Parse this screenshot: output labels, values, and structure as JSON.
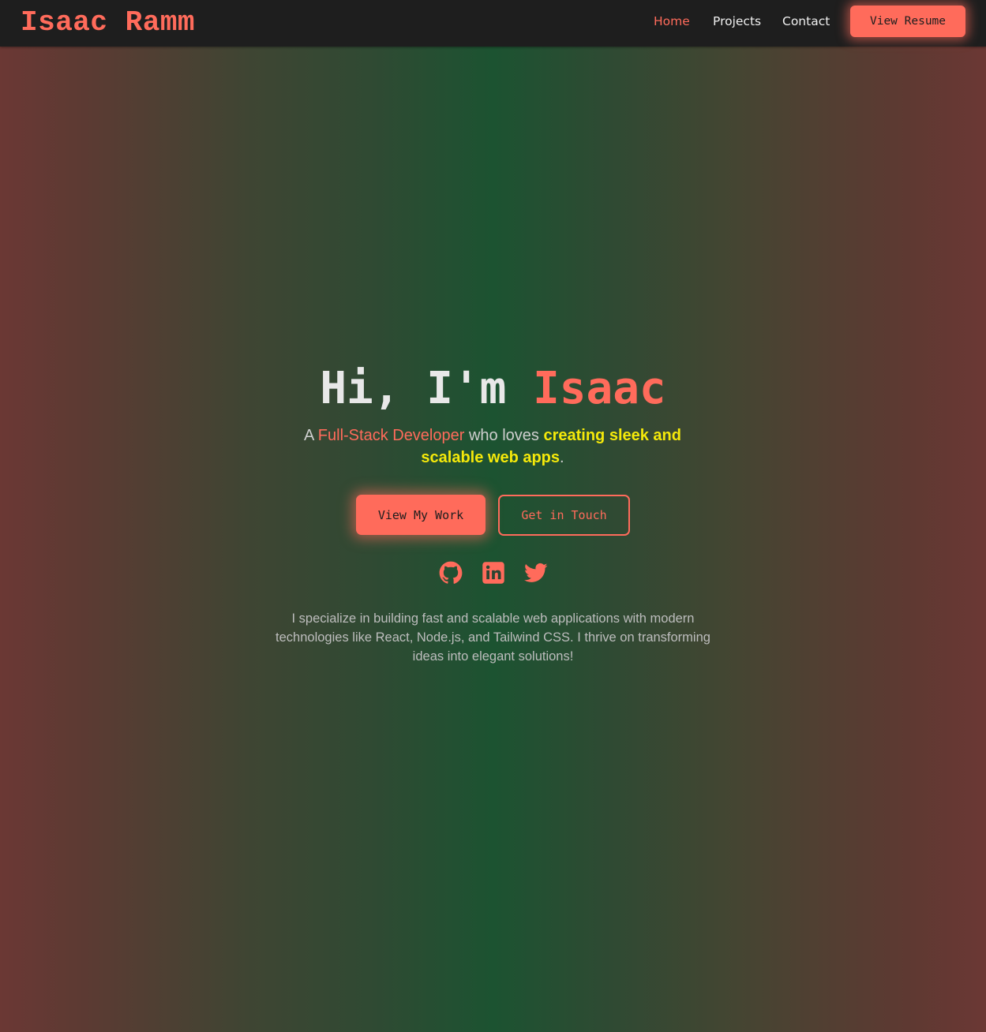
{
  "nav": {
    "brand": "Isaac Ramm",
    "links": [
      {
        "label": "Home",
        "active": true
      },
      {
        "label": "Projects",
        "active": false
      },
      {
        "label": "Contact",
        "active": false
      }
    ],
    "resume_label": "View Resume"
  },
  "hero": {
    "greeting": "Hi, I'm ",
    "name": "Isaac",
    "tagline": {
      "prefix": "A ",
      "role": "Full-Stack Developer",
      "middle": " who loves ",
      "highlight": "creating sleek and scalable web apps",
      "suffix": "."
    },
    "primary_button": "View My Work",
    "secondary_button": "Get in Touch",
    "social_icons": [
      "github-icon",
      "linkedin-icon",
      "twitter-icon"
    ],
    "about": "I specialize in building fast and scalable web applications with modern technologies like React, Node.js, and Tailwind CSS. I thrive on transforming ideas into elegant solutions!"
  },
  "colors": {
    "accent": "#ff6b5b",
    "highlight": "#f5e90a",
    "navbar_bg": "#1e1e1e",
    "gradient_center": "#1c5331",
    "gradient_edge": "#6b3834"
  }
}
